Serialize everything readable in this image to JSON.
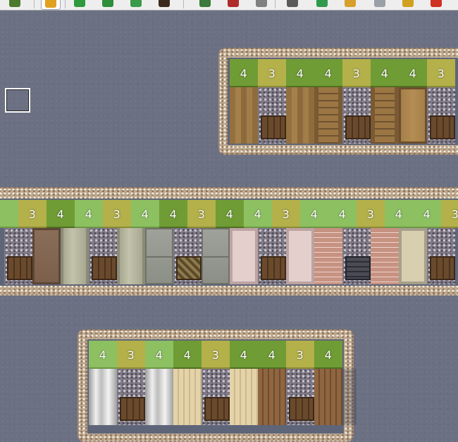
{
  "toolbar": {
    "tools": [
      {
        "name": "terrain-icon",
        "color": "#4c7a2c"
      },
      {
        "name": "pencil-icon",
        "color": "#e0a020",
        "active": true
      },
      {
        "name": "rectangle-icon",
        "color": "#2e9a3e"
      },
      {
        "name": "ellipse-icon",
        "color": "#2e8f3a"
      },
      {
        "name": "flood-fill-icon",
        "color": "#3a9a48"
      },
      {
        "name": "shadow-pen-icon",
        "color": "#3b2a1c"
      },
      {
        "name": "zoom-in-icon",
        "color": "#3a7a3a"
      },
      {
        "name": "zoom-out-icon",
        "color": "#b02a2a"
      },
      {
        "name": "actual-size-icon",
        "color": "#808080"
      },
      {
        "name": "settings-icon",
        "color": "#5a5a5a"
      },
      {
        "name": "resource-manager-icon",
        "color": "#2f9a4c"
      },
      {
        "name": "script-editor-icon",
        "color": "#d7a02a"
      },
      {
        "name": "sound-test-icon",
        "color": "#9aa0a8"
      },
      {
        "name": "database-icon",
        "color": "#d2a020"
      },
      {
        "name": "playtest-icon",
        "color": "#d03020"
      }
    ]
  },
  "map": {
    "blocks": [
      {
        "id": "block-1",
        "top_numbers": [
          "4",
          "3",
          "4",
          "4",
          "3",
          "4",
          "4",
          "3"
        ],
        "top_styles": [
          "g4d",
          "g3",
          "g4d",
          "g4d",
          "g3",
          "g4d",
          "g4d",
          "g3"
        ],
        "walls": [
          "wood",
          "ornate-door",
          "wood",
          "wood-ladder",
          "ornate-door",
          "wood-ladder",
          "wood-door",
          "ornate-door"
        ]
      },
      {
        "id": "block-2",
        "top_numbers": [
          "",
          "3",
          "4",
          "4",
          "3",
          "4",
          "4",
          "3",
          "4",
          "4",
          "3",
          "4",
          "4",
          "3",
          "4",
          "4",
          "3"
        ],
        "top_styles": [
          "g4",
          "g3",
          "g4d",
          "g4",
          "g3",
          "g4",
          "g4d",
          "g3",
          "g4d",
          "g4",
          "g3",
          "g4",
          "g4",
          "g3",
          "g4",
          "g4",
          "g3"
        ],
        "walls": [
          "ornate-door",
          "brown-panel",
          "sage",
          "ornate-door",
          "sage",
          "stone",
          "ornate-mosaic",
          "stone",
          "pink",
          "ornate-door",
          "pink",
          "brick",
          "ornate-metal",
          "brick",
          "cream",
          "ornate-door"
        ]
      },
      {
        "id": "block-3",
        "top_numbers": [
          "4",
          "3",
          "4",
          "4",
          "3",
          "4",
          "4",
          "3",
          "4"
        ],
        "top_styles": [
          "g4",
          "g3",
          "g4",
          "g4d",
          "g3",
          "g4d",
          "g4d",
          "g3",
          "g4d"
        ],
        "walls": [
          "column",
          "ornate-door",
          "column",
          "curtain",
          "ornate-door",
          "curtain",
          "planks",
          "ornate-door",
          "planks"
        ]
      }
    ]
  }
}
